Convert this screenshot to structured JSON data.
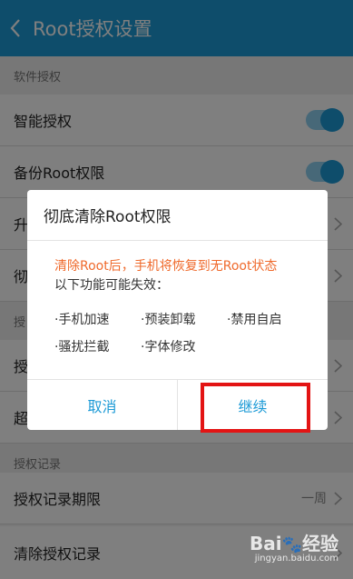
{
  "header": {
    "title": "Root授权设置"
  },
  "sections": {
    "software": "软件授权",
    "authorization_partial": "授",
    "records": "授权记录"
  },
  "rows": {
    "smart_auth": "智能授权",
    "backup_root": "备份Root权限",
    "row3_partial": "升",
    "row4_partial": "彻",
    "row5_partial": "授",
    "row6_partial": "超",
    "record_period": "授权记录期限",
    "record_period_value": "一周",
    "clear_records": "清除授权记录"
  },
  "toggles": {
    "smart_auth": true,
    "backup_root": true
  },
  "dialog": {
    "title": "彻底清除Root权限",
    "warning": "清除Root后，手机将恢复到无Root状态",
    "lost_intro": "以下功能可能失效：",
    "features": [
      "·手机加速",
      "·预装卸载",
      "·禁用自启",
      "·骚扰拦截",
      "·字体修改"
    ],
    "cancel": "取消",
    "continue": "继续"
  },
  "watermark": {
    "main": "Bai",
    "paw": "🐾",
    "du": "经验",
    "sub": "jingyan.baidu.com"
  },
  "colors": {
    "accent": "#1c9ad6",
    "warning": "#ef6a2c",
    "highlight": "#e31414"
  }
}
